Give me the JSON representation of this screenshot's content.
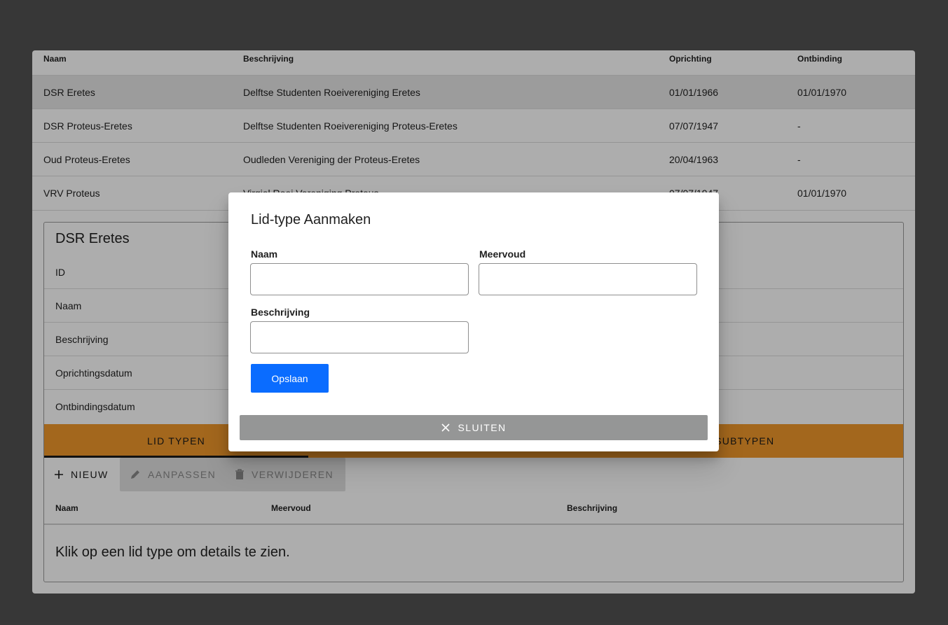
{
  "main_table": {
    "headers": [
      "Naam",
      "Beschrijving",
      "Oprichting",
      "Ontbinding"
    ],
    "rows": [
      {
        "naam": "DSR Eretes",
        "beschrijving": "Delftse Studenten Roeivereniging Eretes",
        "oprichting": "01/01/1966",
        "ontbinding": "01/01/1970",
        "selected": true
      },
      {
        "naam": "DSR Proteus-Eretes",
        "beschrijving": "Delftse Studenten Roeivereniging Proteus-Eretes",
        "oprichting": "07/07/1947",
        "ontbinding": "-"
      },
      {
        "naam": "Oud Proteus-Eretes",
        "beschrijving": "Oudleden Vereniging der Proteus-Eretes",
        "oprichting": "20/04/1963",
        "ontbinding": "-"
      },
      {
        "naam": "VRV Proteus",
        "beschrijving": "Virgiel Roei Vereniging Proteus",
        "oprichting": "07/07/1947",
        "ontbinding": "01/01/1970"
      }
    ]
  },
  "detail": {
    "title": "DSR Eretes",
    "fields": [
      "ID",
      "Naam",
      "Beschrijving",
      "Oprichtingsdatum",
      "Ontbindingsdatum"
    ],
    "tabs": [
      "LID TYPEN",
      "GROEP SUBTYPEN"
    ],
    "tabs_visible": [
      "LID TYPEN",
      "DEP SUBTYPEN"
    ],
    "toolbar": {
      "new": "NIEUW",
      "edit": "AANPASSEN",
      "delete": "VERWIJDEREN"
    },
    "sub_headers": [
      "Naam",
      "Meervoud",
      "Beschrijving"
    ],
    "empty_message": "Klik op een lid type om details te zien."
  },
  "modal": {
    "title": "Lid-type Aanmaken",
    "naam_label": "Naam",
    "naam_value": "",
    "meervoud_label": "Meervoud",
    "meervoud_value": "",
    "beschrijving_label": "Beschrijving",
    "beschrijving_value": "",
    "save_label": "Opslaan",
    "close_label": "SLUITEN"
  },
  "colors": {
    "accent": "#0a6cff",
    "tab_bar": "#f0982c",
    "close_bar": "#959696",
    "background": "#525252"
  }
}
